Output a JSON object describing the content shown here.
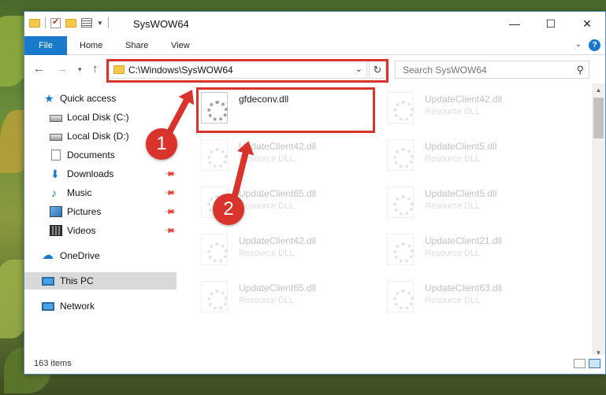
{
  "window": {
    "title": "SysWOW64",
    "buttons": {
      "minimize": "—",
      "maximize": "☐",
      "close": "✕"
    }
  },
  "ribbon": {
    "file": "File",
    "tabs": [
      "Home",
      "Share",
      "View"
    ],
    "help": "?"
  },
  "nav": {
    "address": "C:\\Windows\\SysWOW64",
    "search_placeholder": "Search SysWOW64"
  },
  "sidebar": {
    "items": [
      {
        "label": "Quick access",
        "icon": "star-icon"
      },
      {
        "label": "Local Disk (C:)",
        "icon": "disk-icon"
      },
      {
        "label": "Local Disk (D:)",
        "icon": "disk-icon"
      },
      {
        "label": "Documents",
        "icon": "documents-icon"
      },
      {
        "label": "Downloads",
        "icon": "download-icon"
      },
      {
        "label": "Music",
        "icon": "music-icon"
      },
      {
        "label": "Pictures",
        "icon": "pictures-icon"
      },
      {
        "label": "Videos",
        "icon": "videos-icon"
      },
      {
        "label": "OneDrive",
        "icon": "cloud-icon"
      },
      {
        "label": "This PC",
        "icon": "computer-icon"
      },
      {
        "label": "Network",
        "icon": "network-icon"
      }
    ]
  },
  "files": [
    {
      "name": "gfdeconv.dll",
      "type": ""
    },
    {
      "name": "UpdateClient42.dll",
      "type": "Resource DLL"
    },
    {
      "name": "UpdateClient42.dll",
      "type": "Resource DLL"
    },
    {
      "name": "UpdateClient5.dll",
      "type": "Resource DLL"
    },
    {
      "name": "UpdateClient65.dll",
      "type": "Resource DLL"
    },
    {
      "name": "UpdateClient5.dll",
      "type": "Resource DLL"
    },
    {
      "name": "UpdateClient42.dll",
      "type": "Resource DLL"
    },
    {
      "name": "UpdateClient21.dll",
      "type": "Resource DLL"
    },
    {
      "name": "UpdateClient65.dll",
      "type": "Resource DLL"
    },
    {
      "name": "UpdateClient63.dll",
      "type": "Resource DLL"
    }
  ],
  "status": {
    "item_count": "163 items"
  },
  "annotations": {
    "step1": "1",
    "step2": "2",
    "color": "#d9342b"
  }
}
